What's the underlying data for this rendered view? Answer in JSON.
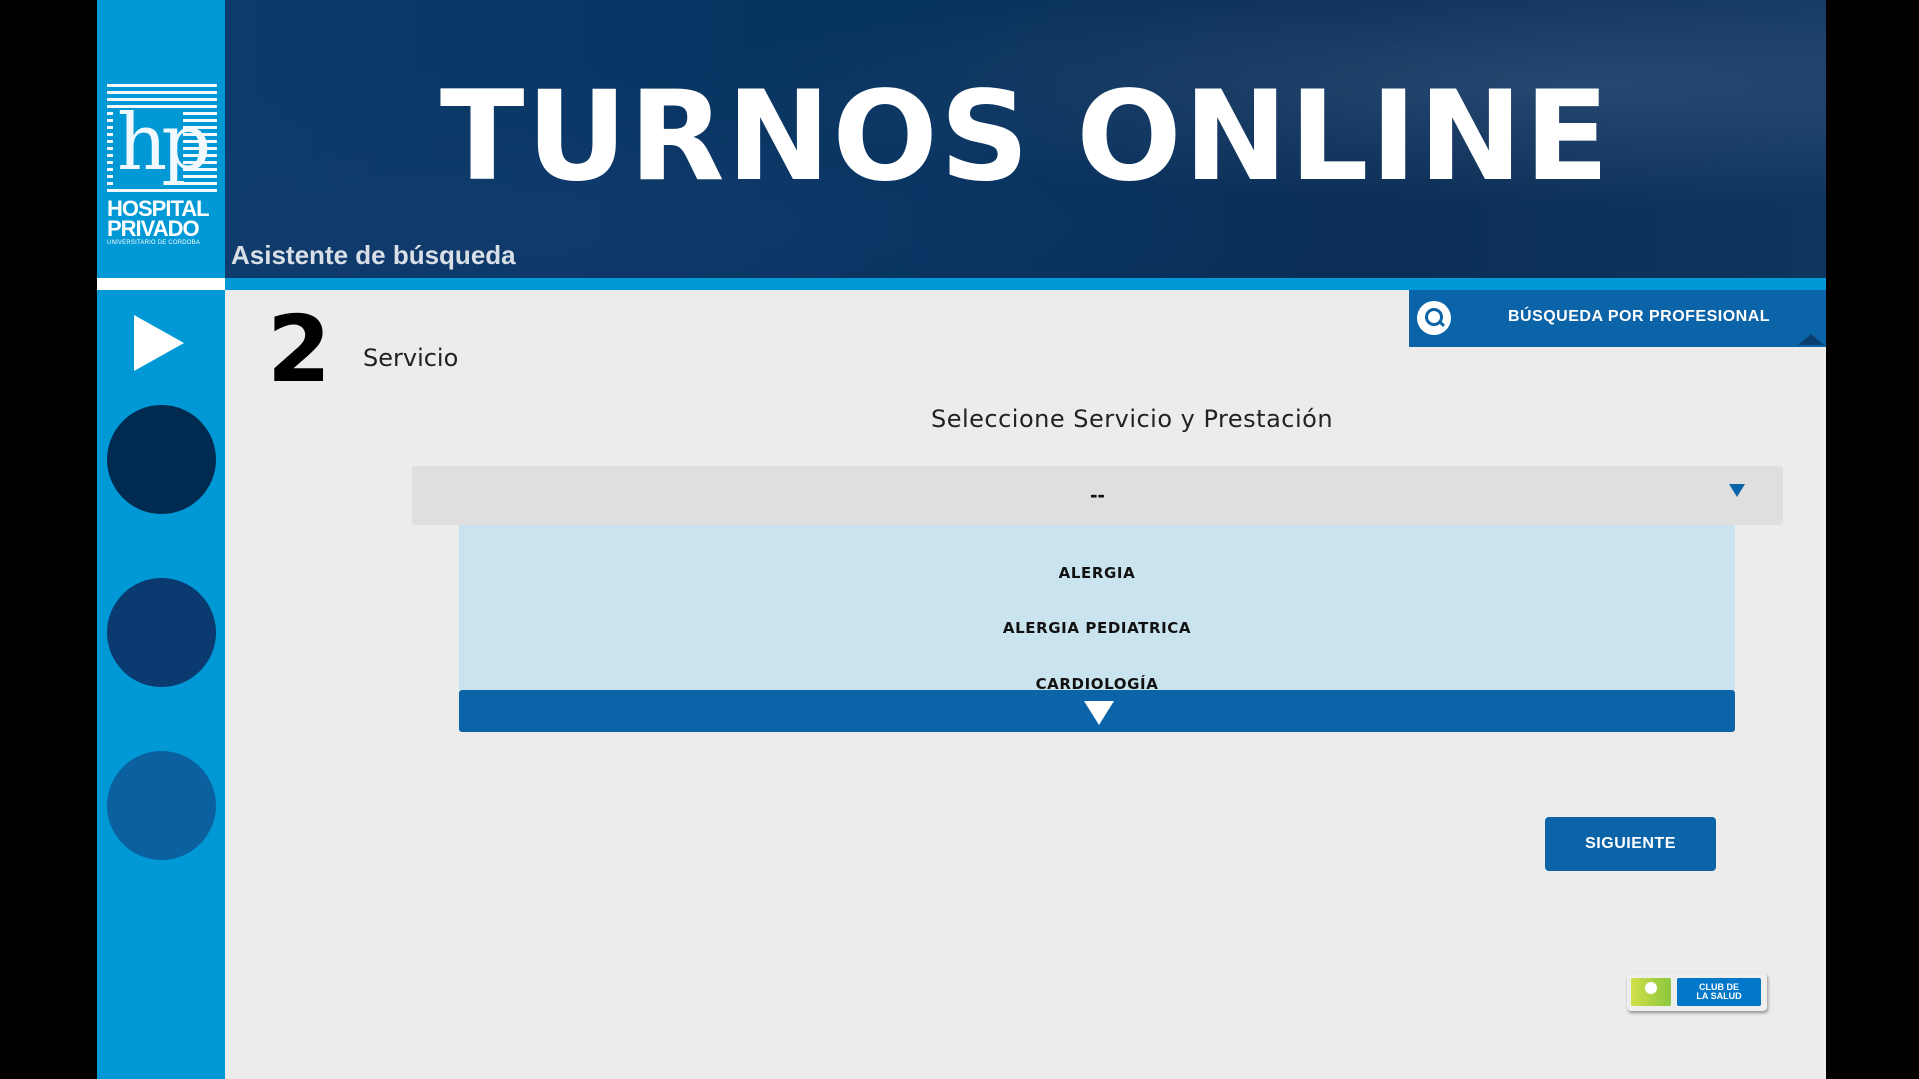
{
  "banner": {
    "title": "TURNOS ONLINE",
    "subtitle": "Asistente de búsqueda"
  },
  "logo": {
    "mark": "hp",
    "name_line1": "HOSPITAL",
    "name_line2": "PRIVADO",
    "sub": "UNIVERSITARIO DE CORDOBA"
  },
  "sidebar": {
    "play_icon": "play-icon",
    "steps": [
      {
        "color": "#002a50"
      },
      {
        "color": "#0a3a70"
      },
      {
        "color": "#0b609f"
      }
    ]
  },
  "header": {
    "search_professional_label": "BÚSQUEDA POR PROFESIONAL",
    "search_icon": "search-icon"
  },
  "step": {
    "number": "2",
    "label": "Servicio",
    "instruction": "Seleccione Servicio y Prestación"
  },
  "select": {
    "value": "--",
    "options": [
      "ALERGIA",
      "ALERGIA PEDIATRICA",
      "CARDIOLOGÍA"
    ]
  },
  "buttons": {
    "next": "SIGUIENTE"
  },
  "club": {
    "line1": "CLUB DE",
    "line2": "LA SALUD"
  },
  "colors": {
    "sidebar": "#0099d6",
    "primary": "#0b63a8",
    "options_bg": "#c9e4ee",
    "select_bg": "#dfdfdf"
  }
}
